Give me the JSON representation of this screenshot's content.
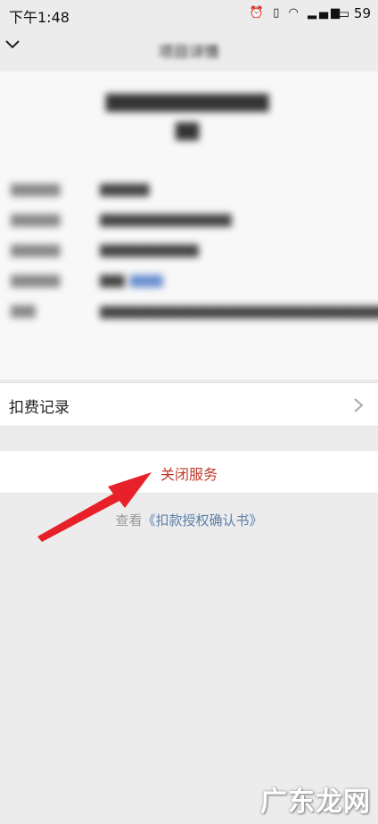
{
  "status_bar": {
    "time": "下午1:48",
    "icons": [
      "alarm-icon",
      "vibrate-icon",
      "wifi-icon",
      "signal-icon",
      "signal-hd-icon"
    ],
    "battery": "59"
  },
  "nav": {
    "back_icon": "chevron-down-icon",
    "title": "项目详情"
  },
  "detail": {
    "title_lines": [
      "██████████████",
      "██"
    ],
    "rows": [
      {
        "label": "██████",
        "value": "██████"
      },
      {
        "label": "██████",
        "value": "████████████████"
      },
      {
        "label": "██████",
        "value": "████████████"
      },
      {
        "label": "██████",
        "value": "███",
        "link": "████"
      },
      {
        "label": "███",
        "value": "████████████████████████████████████████████████████████████"
      }
    ]
  },
  "fee_records": {
    "label": "扣费记录",
    "icon": "chevron-right-icon"
  },
  "close_service": {
    "label": "关闭服务",
    "color": "#c0392b"
  },
  "agreement": {
    "prefix": "查看",
    "link": "《扣款授权确认书》",
    "link_color": "#5a7fa8"
  },
  "annotation": {
    "arrow_color": "#e8202a"
  },
  "watermark": {
    "text": "广东龙网"
  }
}
